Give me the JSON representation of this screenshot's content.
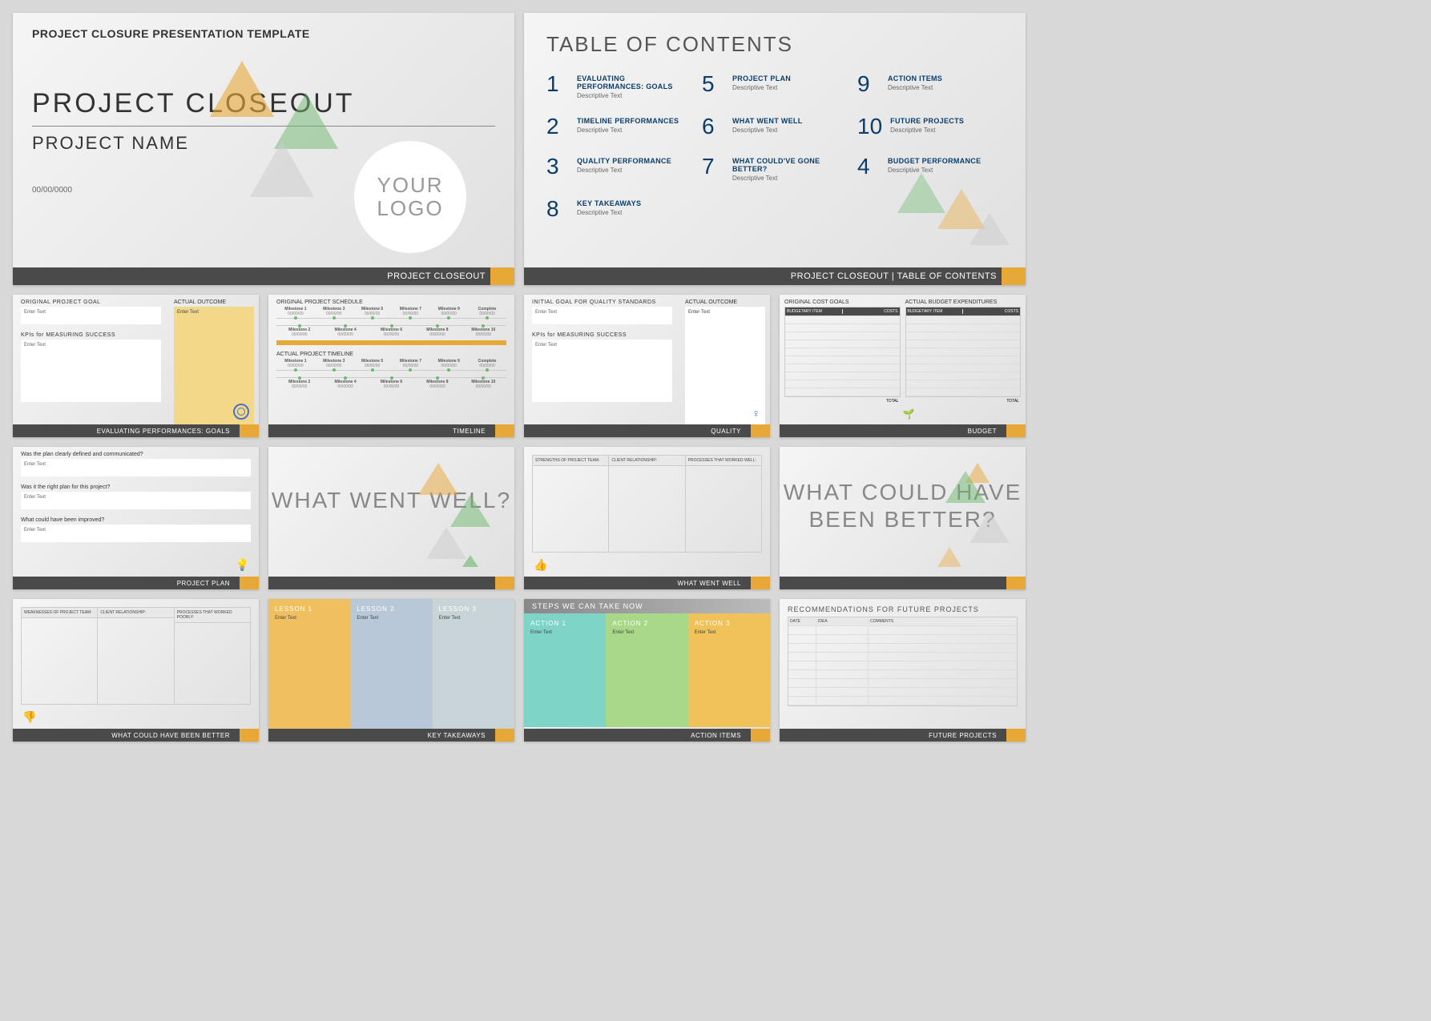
{
  "slide1": {
    "header": "PROJECT CLOSURE PRESENTATION TEMPLATE",
    "title": "PROJECT CLOSEOUT",
    "subtitle": "PROJECT NAME",
    "date": "00/00/0000",
    "logo": "YOUR LOGO",
    "footer": "PROJECT CLOSEOUT"
  },
  "slide2": {
    "title": "TABLE OF CONTENTS",
    "items": [
      {
        "n": "1",
        "name": "EVALUATING PERFORMANCES: GOALS",
        "desc": "Descriptive Text"
      },
      {
        "n": "5",
        "name": "PROJECT PLAN",
        "desc": "Descriptive Text"
      },
      {
        "n": "9",
        "name": "ACTION ITEMS",
        "desc": "Descriptive Text"
      },
      {
        "n": "2",
        "name": "TIMELINE PERFORMANCES",
        "desc": "Descriptive Text"
      },
      {
        "n": "6",
        "name": "WHAT WENT WELL",
        "desc": "Descriptive Text"
      },
      {
        "n": "10",
        "name": "FUTURE PROJECTS",
        "desc": "Descriptive Text"
      },
      {
        "n": "3",
        "name": "QUALITY PERFORMANCE",
        "desc": "Descriptive Text"
      },
      {
        "n": "7",
        "name": "WHAT COULD'VE GONE BETTER?",
        "desc": "Descriptive Text"
      },
      {
        "n": "4",
        "name": "BUDGET PERFORMANCE",
        "desc": "Descriptive Text"
      },
      {
        "n": "8",
        "name": "KEY TAKEAWAYS",
        "desc": "Descriptive Text"
      }
    ],
    "footer": "PROJECT CLOSEOUT   |   TABLE OF CONTENTS"
  },
  "slide3": {
    "h1": "ORIGINAL PROJECT GOAL",
    "t1": "Enter Text",
    "h2": "KPIs for MEASURING SUCCESS",
    "t2": "Enter Text",
    "h3": "ACTUAL OUTCOME",
    "t3": "Enter Text",
    "footer": "EVALUATING PERFORMANCES: GOALS"
  },
  "slide4": {
    "h1": "ORIGINAL PROJECT SCHEDULE",
    "h2": "ACTUAL PROJECT TIMELINE",
    "top": [
      {
        "name": "Milestone 1",
        "date": "00/00/00"
      },
      {
        "name": "Milestone 3",
        "date": "00/00/00"
      },
      {
        "name": "Milestone 5",
        "date": "00/00/00"
      },
      {
        "name": "Milestone 7",
        "date": "00/00/00"
      },
      {
        "name": "Milestone 9",
        "date": "00/00/00"
      },
      {
        "name": "Complete",
        "date": "00/00/00"
      }
    ],
    "bot": [
      {
        "name": "Milestone 2",
        "date": "00/00/00"
      },
      {
        "name": "Milestone 4",
        "date": "00/00/00"
      },
      {
        "name": "Milestone 6",
        "date": "00/00/00"
      },
      {
        "name": "Milestone 8",
        "date": "00/00/00"
      },
      {
        "name": "Milestone 10",
        "date": "00/00/00"
      }
    ],
    "footer": "TIMELINE"
  },
  "slide5": {
    "h1": "INITIAL GOAL FOR QUALITY STANDARDS",
    "t1": "Enter Text",
    "h2": "KPIs for MEASURING SUCCESS",
    "t2": "Enter Text",
    "h3": "ACTUAL OUTCOME",
    "t3": "Enter Text",
    "footer": "QUALITY"
  },
  "slide6": {
    "h1": "ORIGINAL COST GOALS",
    "h2": "ACTUAL BUDGET EXPENDITURES",
    "col1": "BUDGETARY ITEM",
    "col2": "COSTS",
    "total": "TOTAL",
    "footer": "BUDGET"
  },
  "slide7": {
    "q1": "Was the plan clearly defined and communicated?",
    "t1": "Enter Text",
    "q2": "Was it the right plan for this project?",
    "t2": "Enter Text",
    "q3": "What could have been improved?",
    "t3": "Enter Text",
    "footer": "PROJECT PLAN"
  },
  "slide8": {
    "title": "WHAT WENT WELL?",
    "footer": ""
  },
  "slide9": {
    "c1": "STRENGTHS OF PROJECT TEAM:",
    "c2": "CLIENT RELATIONSHIP:",
    "c3": "PROCESSES THAT WORKED WELL:",
    "footer": "WHAT WENT WELL"
  },
  "slide10": {
    "title": "WHAT COULD HAVE BEEN BETTER?",
    "footer": ""
  },
  "slide11": {
    "c1": "WEAKNESSES OF PROJECT TEAM:",
    "c2": "CLIENT RELATIONSHIP:",
    "c3": "PROCESSES THAT WORKED POORLY:",
    "footer": "WHAT COULD HAVE BEEN BETTER"
  },
  "slide12": {
    "l1": "LESSON 1",
    "l2": "LESSON 2",
    "l3": "LESSON 3",
    "t": "Enter Text",
    "footer": "KEY TAKEAWAYS"
  },
  "slide13": {
    "title": "STEPS WE CAN TAKE NOW",
    "a1": "ACTION 1",
    "a2": "ACTION 2",
    "a3": "ACTION 3",
    "t": "Enter Text",
    "footer": "ACTION ITEMS"
  },
  "slide14": {
    "title": "RECOMMENDATIONS FOR FUTURE PROJECTS",
    "c1": "DATE",
    "c2": "IDEA",
    "c3": "COMMENTS",
    "footer": "FUTURE PROJECTS"
  }
}
